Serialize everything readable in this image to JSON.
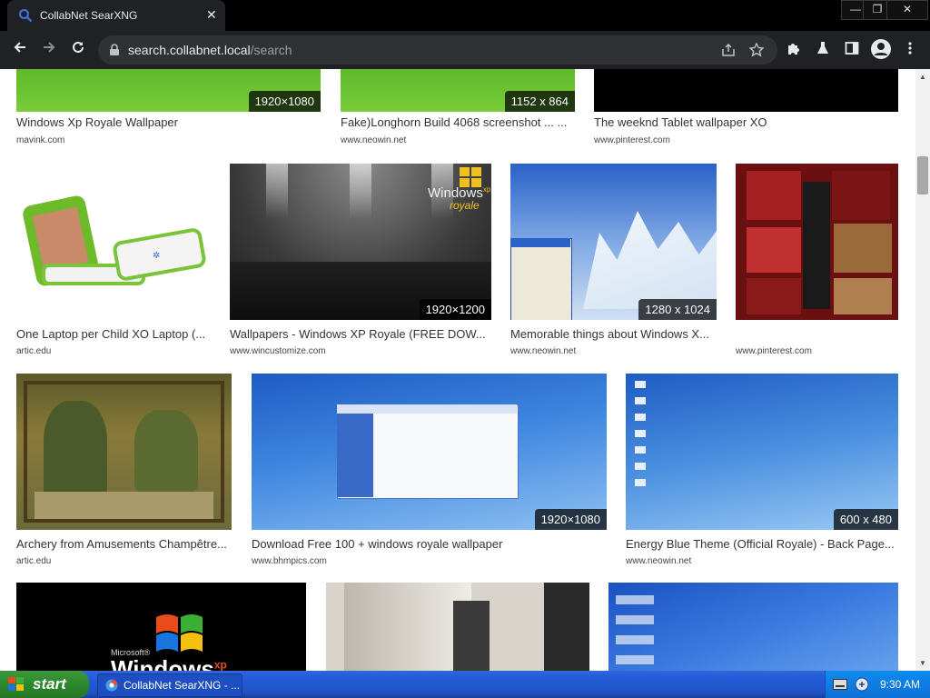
{
  "browser": {
    "tab_title": "CollabNet SearXNG",
    "tab_close": "✕",
    "url_host": "search.collabnet.local",
    "url_path": "/search",
    "window_controls": [
      "—",
      "❐",
      "✕"
    ]
  },
  "results": [
    {
      "title": "Windows Xp Royale Wallpaper",
      "source": "mavink.com",
      "resolution": "1920×1080",
      "thumb": "green-field"
    },
    {
      "title": "Fake)Longhorn Build 4068 screenshot ... ...",
      "source": "www.neowin.net",
      "resolution": "1152 x 864",
      "thumb": "green-field"
    },
    {
      "title": "The weeknd Tablet wallpaper XO",
      "source": "www.pinterest.com",
      "resolution": "",
      "thumb": "black"
    },
    {
      "title": "One Laptop per Child XO Laptop (...",
      "source": "artic.edu",
      "resolution": "",
      "thumb": "xo-laptop"
    },
    {
      "title": "Wallpapers - Windows XP Royale (FREE DOW...",
      "source": "www.wincustomize.com",
      "resolution": "1920×1200",
      "thumb": "royale-stage",
      "logo_text": "Windows",
      "logo_sup": "xp",
      "logo_sub": "royale"
    },
    {
      "title": "Memorable things about Windows X...",
      "source": "www.neowin.net",
      "resolution": "1280 x 1024",
      "thumb": "winter-desktop"
    },
    {
      "title": "",
      "source": "www.pinterest.com",
      "resolution": "",
      "thumb": "red-collage"
    },
    {
      "title": "Archery from Amusements Champêtre...",
      "source": "artic.edu",
      "resolution": "",
      "thumb": "tapestry"
    },
    {
      "title": "Download Free 100 + windows royale wallpaper",
      "source": "www.bhmpics.com",
      "resolution": "1920×1080",
      "thumb": "blue-explorer"
    },
    {
      "title": "Energy Blue Theme (Official Royale) - Back Page...",
      "source": "www.neowin.net",
      "resolution": "600 x 480",
      "thumb": "blue-desktop"
    },
    {
      "title": "",
      "source": "",
      "resolution": "",
      "thumb": "xp-logo",
      "logo_brand": "Microsoft®",
      "logo_text": "Windows",
      "logo_sup": "xp"
    },
    {
      "title": "",
      "source": "",
      "resolution": "",
      "thumb": "engraving"
    },
    {
      "title": "",
      "source": "",
      "resolution": "",
      "thumb": "blue-desktop-2"
    }
  ],
  "taskbar": {
    "start_label": "start",
    "task_label": "CollabNet SearXNG - ...",
    "clock": "9:30 AM"
  }
}
